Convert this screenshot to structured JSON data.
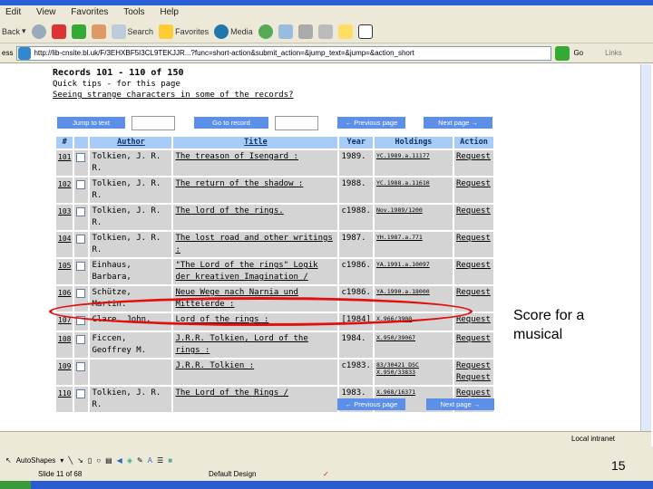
{
  "browser": {
    "menu": [
      "Edit",
      "View",
      "Favorites",
      "Tools",
      "Help"
    ],
    "toolbar": {
      "back": "Back",
      "search": "Search",
      "favorites": "Favorites",
      "media": "Media"
    },
    "address_label": "ess",
    "url": "http://lib-cnsite.bl.uk/F/3EHXBF5I3CL9TEKJJR...?func=short-action&submit_action=&jump_text=&jump=&action_short",
    "go": "Go",
    "links": "Links",
    "status_zone": "Local intranet"
  },
  "page": {
    "records_heading": "Records 101 - 110 of 150",
    "quick_tips": "Quick tips - for this page",
    "strange_link": "Seeing strange characters in some of the records?",
    "jump_to_text": "Jump to text",
    "go_to_record": "Go to record",
    "prev_page": "← Previous page",
    "next_page": "Next page →"
  },
  "table": {
    "headers": [
      "#",
      "",
      "Author",
      "Title",
      "Year",
      "Holdings",
      "Action"
    ],
    "rows": [
      {
        "num": "101",
        "author": "Tolkien, J. R. R.",
        "title": "The treason of Isengard :",
        "title_link": false,
        "year": "1989.",
        "holdings": [
          "YC.1989.a.11177"
        ],
        "actions": [
          "Request"
        ]
      },
      {
        "num": "102",
        "author": "Tolkien, J. R. R.",
        "title": "The return of the shadow :",
        "title_link": true,
        "year": "1988.",
        "holdings": [
          "YC.1988.a.11610"
        ],
        "actions": [
          "Request"
        ]
      },
      {
        "num": "103",
        "author": "Tolkien, J. R. R.",
        "title": "The lord of the rings.",
        "title_link": false,
        "year": "c1988.",
        "holdings": [
          "Nov.1989/1200"
        ],
        "actions": [
          "Request"
        ]
      },
      {
        "num": "104",
        "author": "Tolkien, J. R. R.",
        "title": "The lost road and other writings :",
        "title_link": true,
        "year": "1987.",
        "holdings": [
          "YH.1987.a.771"
        ],
        "actions": [
          "Request"
        ]
      },
      {
        "num": "105",
        "author": "Einhaus, Barbara,",
        "title": "\"The Lord of the rings\" Logik der kreativen Imagination /",
        "title_link": false,
        "year": "c1986.",
        "holdings": [
          "YA.1991.a.10097"
        ],
        "actions": [
          "Request"
        ]
      },
      {
        "num": "106",
        "author": "Schütze, Martin.",
        "title": "Neue Wege nach Narnia und Mittelerde :",
        "title_link": true,
        "year": "c1986.",
        "holdings": [
          "YA.1990.a.18000"
        ],
        "actions": [
          "Request"
        ]
      },
      {
        "num": "107",
        "author": "Clare, John.",
        "title": "Lord of the rings :",
        "title_link": false,
        "year": "[1984]",
        "holdings": [
          "X.966/3900"
        ],
        "actions": [
          "Request"
        ]
      },
      {
        "num": "108",
        "author": "Ficcen, Geoffrey M.",
        "title": "J.R.R. Tolkien, Lord of the rings :",
        "title_link": false,
        "year": "1984.",
        "holdings": [
          "X.950/39067"
        ],
        "actions": [
          "Request"
        ]
      },
      {
        "num": "109",
        "author": "",
        "title": "J.R.R. Tolkien :",
        "title_link": true,
        "year": "c1983.",
        "holdings": [
          "83/30421 DSC",
          "X.950/33833"
        ],
        "actions": [
          "Request",
          "Request"
        ]
      },
      {
        "num": "110",
        "author": "Tolkien, J. R. R.",
        "title": "The Lord of the Rings /",
        "title_link": false,
        "year": "1983.",
        "holdings": [
          "X.968/16371"
        ],
        "actions": [
          "Request"
        ]
      }
    ]
  },
  "annotation": {
    "text": "Score for a musical",
    "color": "#e01010"
  },
  "powerpoint": {
    "autoshapes": "AutoShapes",
    "slide_status": "Slide 11 of 68",
    "design": "Default Design",
    "page_number": "15"
  }
}
